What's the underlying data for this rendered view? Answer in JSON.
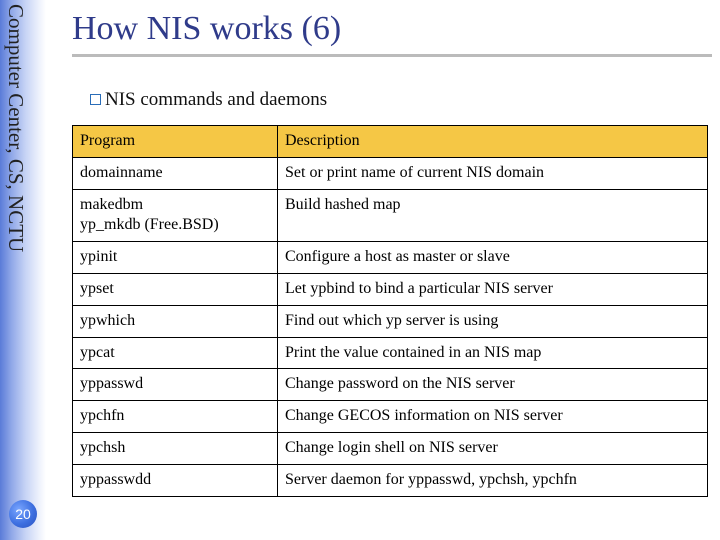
{
  "sidebar": {
    "org_text": "Computer Center, CS, NCTU"
  },
  "page_number": "20",
  "title": "How NIS works (6)",
  "subheading": "NIS commands and daemons",
  "table": {
    "headers": {
      "program": "Program",
      "description": "Description"
    },
    "rows": [
      {
        "program": "domainname",
        "description": "Set or print name of current NIS domain"
      },
      {
        "program": "makedbm\nyp_mkdb (Free.BSD)",
        "description": "Build hashed map"
      },
      {
        "program": "ypinit",
        "description": "Configure a host as master or slave"
      },
      {
        "program": "ypset",
        "description": "Let ypbind to bind a particular NIS server"
      },
      {
        "program": "ypwhich",
        "description": "Find out which yp server is using"
      },
      {
        "program": "ypcat",
        "description": "Print the value contained in an NIS map"
      },
      {
        "program": "yppasswd",
        "description": "Change password on the NIS server"
      },
      {
        "program": "ypchfn",
        "description": "Change GECOS information on NIS server"
      },
      {
        "program": "ypchsh",
        "description": "Change login shell on NIS server"
      },
      {
        "program": "yppasswdd",
        "description": "Server daemon for yppasswd, ypchsh, ypchfn"
      }
    ]
  }
}
